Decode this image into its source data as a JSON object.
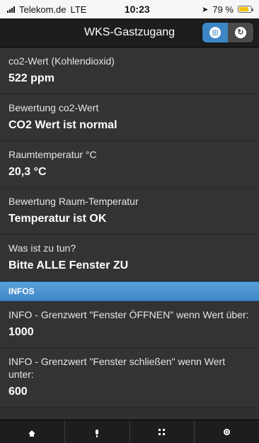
{
  "status_bar": {
    "carrier": "Telekom.de",
    "network": "LTE",
    "time": "10:23",
    "location_icon": "location-arrow-icon",
    "battery_text": "79 %",
    "battery_level": 0.79,
    "battery_color": "#f4c20d"
  },
  "header": {
    "title": "WKS-Gastzugang",
    "buttons": [
      {
        "icon": "grid-icon",
        "active": true
      },
      {
        "icon": "refresh-icon",
        "active": false
      }
    ],
    "accent": "#3d86c6"
  },
  "items": [
    {
      "label": "co2-Wert (Kohlendioxid)",
      "value": "522 ppm"
    },
    {
      "label": "Bewertung co2-Wert",
      "value": "CO2 Wert ist normal"
    },
    {
      "label": "Raumtemperatur °C",
      "value": "20,3 °C"
    },
    {
      "label": "Bewertung Raum-Temperatur",
      "value": "Temperatur ist OK"
    },
    {
      "label": "Was ist zu tun?",
      "value": "Bitte ALLE Fenster ZU"
    }
  ],
  "infos_section": {
    "title": "INFOS",
    "items": [
      {
        "label": "INFO - Grenzwert \"Fenster ÖFFNEN\" wenn Wert über:",
        "value": "1000"
      },
      {
        "label": "INFO - Grenzwert \"Fenster schließen\" wenn Wert unter:",
        "value": "600"
      }
    ]
  },
  "footer_nav": [
    {
      "icon": "home-icon"
    },
    {
      "icon": "microphone-icon"
    },
    {
      "icon": "qr-code-icon"
    },
    {
      "icon": "gear-icon"
    }
  ]
}
